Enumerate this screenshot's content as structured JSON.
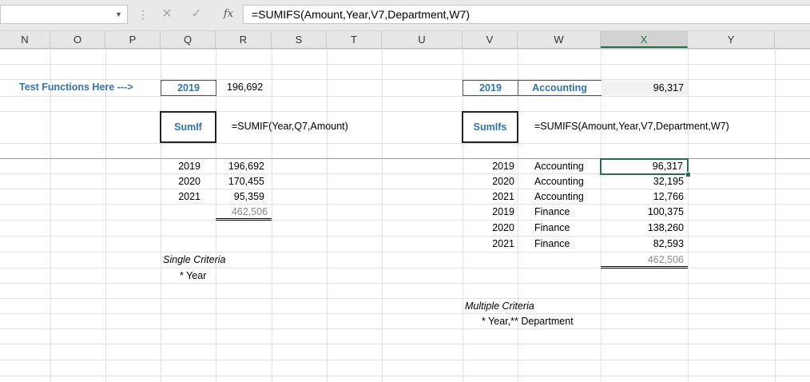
{
  "formula_bar": {
    "name_box": "",
    "cancel_icon": "✕",
    "enter_icon": "✓",
    "fx_label": "fx",
    "formula": "=SUMIFS(Amount,Year,V7,Department,W7)"
  },
  "columns": [
    "N",
    "O",
    "P",
    "Q",
    "R",
    "S",
    "T",
    "U",
    "V",
    "W",
    "X",
    "Y"
  ],
  "active_column": "X",
  "test_row": {
    "label": "Test Functions Here --->",
    "sumif_year": "2019",
    "sumif_result": "196,692",
    "sumifs_year": "2019",
    "sumifs_dept": "Accounting",
    "sumifs_result": "96,317"
  },
  "function_row": {
    "sumif_label": "SumIf",
    "sumif_formula": "=SUMIF(Year,Q7,Amount)",
    "sumifs_label": "SumIfs",
    "sumifs_formula": "=SUMIFS(Amount,Year,V7,Department,W7)"
  },
  "sumif_table": {
    "rows": [
      {
        "year": "2019",
        "amount": "196,692"
      },
      {
        "year": "2020",
        "amount": "170,455"
      },
      {
        "year": "2021",
        "amount": "95,359"
      }
    ],
    "total": "462,506",
    "note_title": "Single Criteria",
    "note_detail": "* Year"
  },
  "sumifs_table": {
    "rows": [
      {
        "year": "2019",
        "dept": "Accounting",
        "amount": "96,317"
      },
      {
        "year": "2020",
        "dept": "Accounting",
        "amount": "32,195"
      },
      {
        "year": "2021",
        "dept": "Accounting",
        "amount": "12,766"
      },
      {
        "year": "2019",
        "dept": "Finance",
        "amount": "100,375"
      },
      {
        "year": "2020",
        "dept": "Finance",
        "amount": "138,260"
      },
      {
        "year": "2021",
        "dept": "Finance",
        "amount": "82,593"
      }
    ],
    "total": "462,506",
    "note_title": "Multiple Criteria",
    "note_detail": "* Year,** Department"
  }
}
